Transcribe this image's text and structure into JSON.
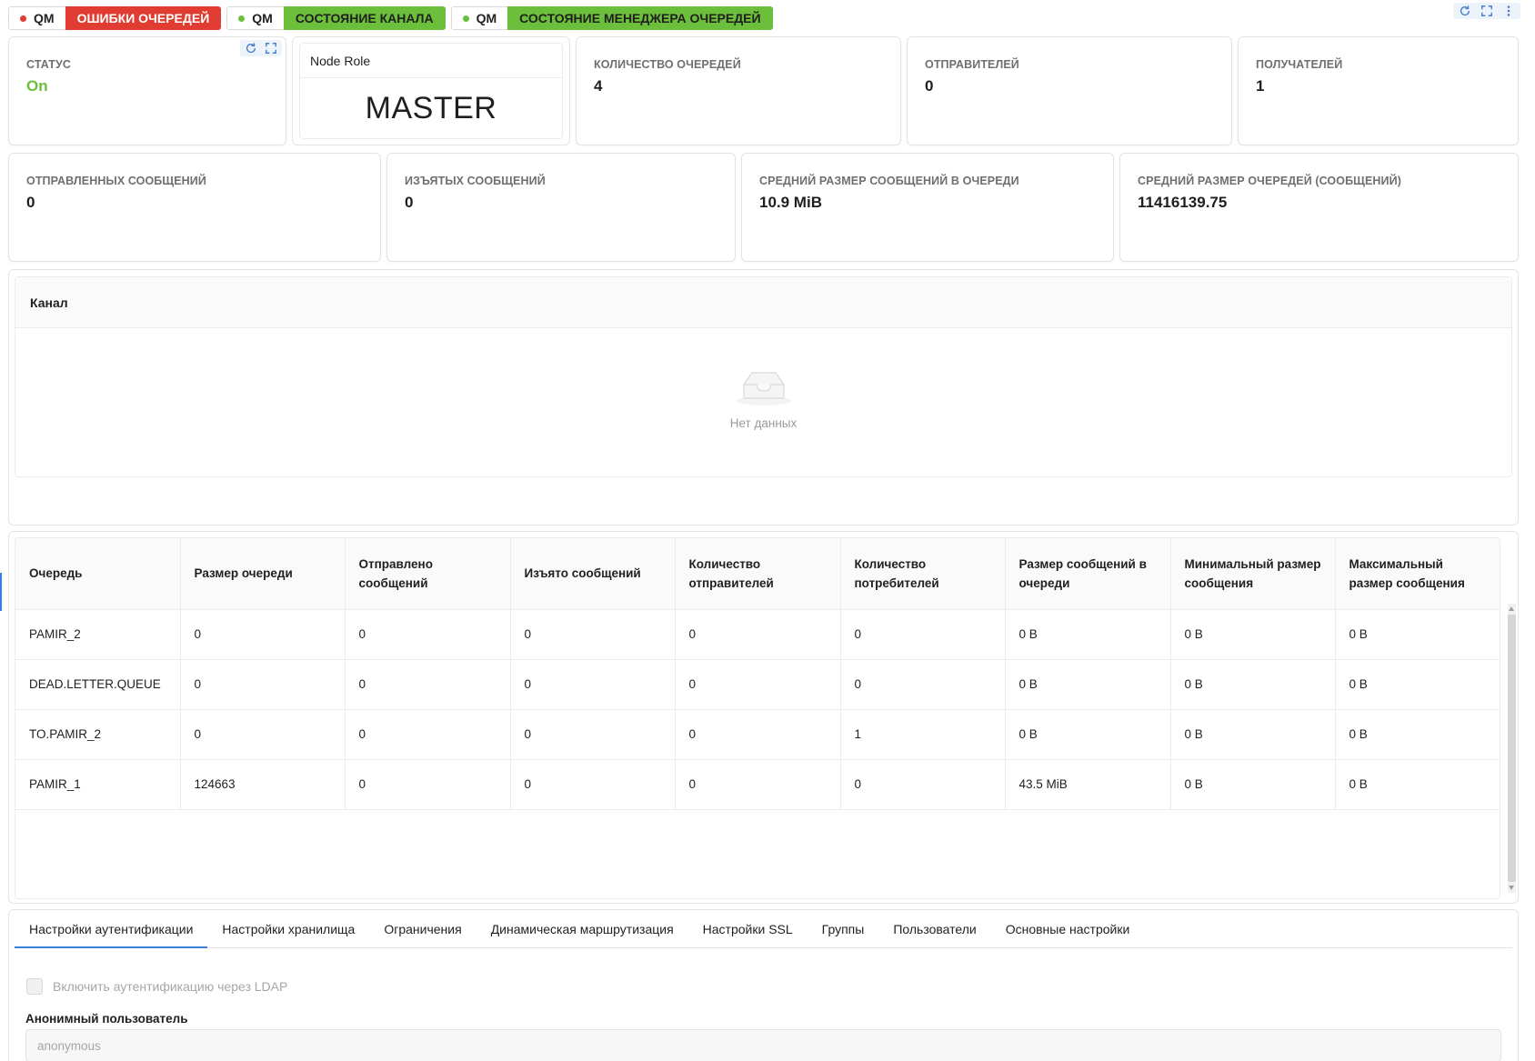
{
  "badges": [
    {
      "prefix": "QM",
      "label": "ОШИБКИ ОЧЕРЕДЕЙ",
      "dot_color": "#e03c31",
      "tag_color": "#e03c31"
    },
    {
      "prefix": "QM",
      "label": "СОСТОЯНИЕ КАНАЛА",
      "dot_color": "#6cbf3a",
      "tag_color": "#6cbf3a"
    },
    {
      "prefix": "QM",
      "label": "СОСТОЯНИЕ МЕНЕДЖЕРА ОЧЕРЕДЕЙ",
      "dot_color": "#6cbf3a",
      "tag_color": "#6cbf3a"
    }
  ],
  "stats_row1": {
    "status": {
      "label": "СТАТУС",
      "value": "On"
    },
    "node": {
      "title": "Node Role",
      "value": "MASTER"
    },
    "queues": {
      "label": "КОЛИЧЕСТВО ОЧЕРЕДЕЙ",
      "value": "4"
    },
    "senders": {
      "label": "ОТПРАВИТЕЛЕЙ",
      "value": "0"
    },
    "receivers": {
      "label": "ПОЛУЧАТЕЛЕЙ",
      "value": "1"
    }
  },
  "stats_row2": {
    "sent": {
      "label": "ОТПРАВЛЕННЫХ СООБЩЕНИЙ",
      "value": "0"
    },
    "taken": {
      "label": "ИЗЪЯТЫХ СООБЩЕНИЙ",
      "value": "0"
    },
    "avg_msg": {
      "label": "СРЕДНИЙ РАЗМЕР СООБЩЕНИЙ В ОЧЕРЕДИ",
      "value": "10.9 MiB"
    },
    "avg_queue": {
      "label": "СРЕДНИЙ РАЗМЕР ОЧЕРЕДЕЙ (СООБЩЕНИЙ)",
      "value": "11416139.75"
    }
  },
  "channel": {
    "header": "Канал",
    "empty_text": "Нет данных"
  },
  "queue_table": {
    "columns": [
      "Очередь",
      "Размер очереди",
      "Отправлено сообщений",
      "Изъято сообщений",
      "Количество отправителей",
      "Количество потребителей",
      "Размер сообщений в очереди",
      "Минимальный размер сообщения",
      "Максимальный размер сообщения"
    ],
    "rows": [
      [
        "PAMIR_2",
        "0",
        "0",
        "0",
        "0",
        "0",
        "0 B",
        "0 B",
        "0 B"
      ],
      [
        "DEAD.LETTER.QUEUE",
        "0",
        "0",
        "0",
        "0",
        "0",
        "0 B",
        "0 B",
        "0 B"
      ],
      [
        "TO.PAMIR_2",
        "0",
        "0",
        "0",
        "0",
        "1",
        "0 B",
        "0 B",
        "0 B"
      ],
      [
        "PAMIR_1",
        "124663",
        "0",
        "0",
        "0",
        "0",
        "43.5 MiB",
        "0 B",
        "0 B"
      ]
    ]
  },
  "settings": {
    "tabs": [
      "Настройки аутентификации",
      "Настройки хранилища",
      "Ограничения",
      "Динамическая маршрутизация",
      "Настройки SSL",
      "Группы",
      "Пользователи",
      "Основные настройки"
    ],
    "active_tab": 0,
    "ldap_checkbox_label": "Включить аутентификацию через LDAP",
    "anon_label": "Анонимный пользователь",
    "anon_value": "anonymous"
  },
  "icons": [
    "refresh-icon",
    "fullscreen-icon",
    "more-icon",
    "inbox-empty-icon"
  ]
}
